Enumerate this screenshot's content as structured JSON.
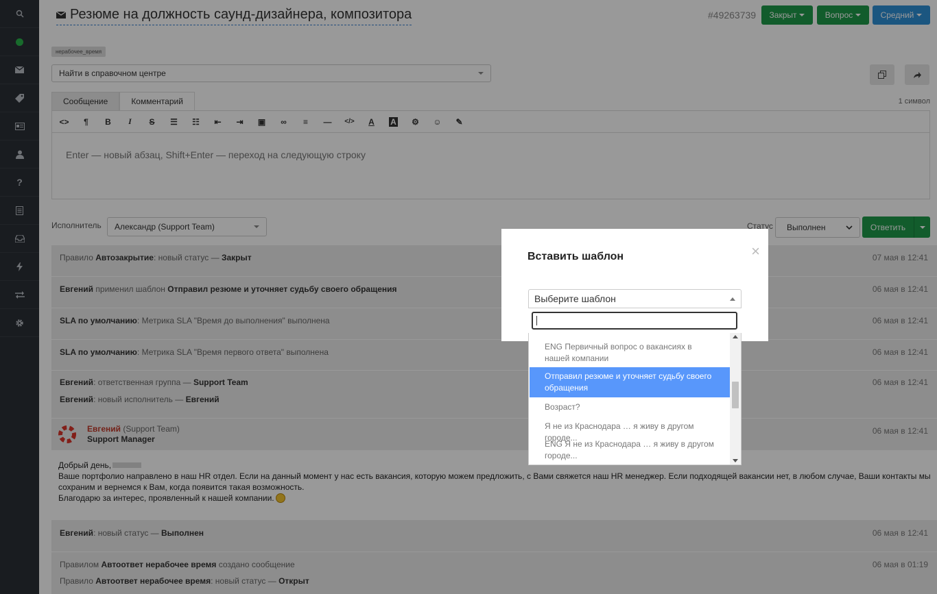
{
  "sidebar": {
    "icons": [
      "search-icon",
      "status-dot-icon",
      "mail-icon",
      "tag-icon",
      "card-icon",
      "user-icon",
      "help-icon",
      "document-icon",
      "inbox-icon",
      "lightning-icon",
      "transfer-icon",
      "gear-icon"
    ]
  },
  "header": {
    "title": "Резюме на должность саунд-дизайнера, композитора",
    "ticket_id": "#49263739",
    "status_btn": "Закрыт",
    "type_btn": "Вопрос",
    "priority_btn": "Средний"
  },
  "tag": "нерабочее_время",
  "kb_search": {
    "placeholder": "Найти в справочном центре"
  },
  "tabs": {
    "message": "Сообщение",
    "comment": "Комментарий"
  },
  "char_count": "1 символ",
  "editor": {
    "placeholder": "Enter — новый абзац, Shift+Enter — переход на следующую строку"
  },
  "assignee": {
    "label": "Исполнитель",
    "value": "Александр (Support Team)"
  },
  "status": {
    "label": "Статус",
    "value": "Выполнен"
  },
  "reply_btn": "Ответить",
  "events": {
    "e1": {
      "p1": "Правило ",
      "b1": "Автозакрытие",
      "p2": ": новый статус — ",
      "b2": "Закрыт",
      "time": "07 мая в 12:41"
    },
    "e2": {
      "b1": "Евгений",
      "p1": " применил шаблон ",
      "b2": "Отправил резюме и уточняет судьбу своего обращения",
      "time": "06 мая в 12:41"
    },
    "e3": {
      "b1": "SLA по умолчанию",
      "p1": ": Метрика SLA \"Время до выполнения\" выполнена",
      "time": "06 мая в 12:41"
    },
    "e4": {
      "b1": "SLA по умолчанию",
      "p1": ": Метрика SLA \"Время первого ответа\" выполнена",
      "time": "06 мая в 12:41"
    },
    "e5": {
      "b1": "Евгений",
      "p1": ": ответственная группа — ",
      "b2": "Support Team",
      "b3": "Евгений",
      "p2": ": новый исполнитель — ",
      "b4": "Евгений",
      "time": "06 мая в 12:41"
    },
    "e7": {
      "b1": "Евгений",
      "p1": ": новый статус — ",
      "b2": "Выполнен",
      "time": "06 мая в 12:41"
    },
    "e8": {
      "p1": "Правилом ",
      "b1": "Автоответ нерабочее время",
      "p2": " создано сообщение",
      "p3": "Правило ",
      "b2": "Автоответ нерабочее время",
      "p4": ": новый статус — ",
      "b3": "Открыт",
      "time": "06 мая в 01:19"
    }
  },
  "message": {
    "author": "Евгений",
    "team": " (Support Team)",
    "role": "Support Manager",
    "time": "06 мая в 12:41",
    "greeting": "Добрый день,",
    "body": "Ваше портфолио направлено в наш HR отдел. Если на данный момент у нас есть вакансия, которую можем предложить, с Вами свяжется наш HR менеджер. Если подходящей вакансии нет, в любом случае, Ваши контакты мы сохраним и вернемся к Вам, когда появится такая возможность.",
    "thanks": "Благодарю за интерес, проявленный к нашей компании."
  },
  "modal": {
    "title": "Вставить шаблон",
    "select_placeholder": "Выберите шаблон",
    "options": [
      "ENG Первичный вопрос о вакансиях в нашей компании",
      "Отправил резюме и уточняет судьбу своего обращения",
      "Возраст?",
      "Я не из Краснодара … я живу в другом городе...",
      "ENG Я не из Краснодара … я живу в другом городе..."
    ],
    "selected_index": 1
  },
  "colors": {
    "sidebar": "#2b2f36",
    "green": "#1e9a4a",
    "blue": "#2d8fd5",
    "highlight": "#5897fb",
    "author_red": "#c0392b"
  }
}
